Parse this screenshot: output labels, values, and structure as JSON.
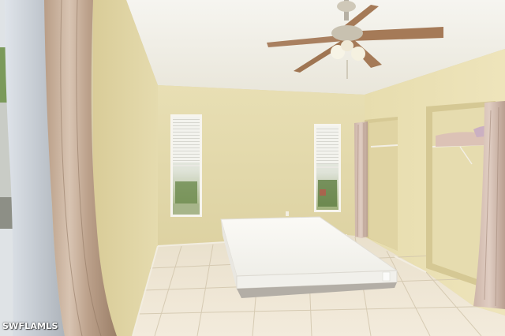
{
  "photo": {
    "watermark": "SWFLAMLS",
    "colors": {
      "ceiling": "#f3f1ea",
      "wall": "#e6dcae",
      "floor_tile": "#eee5d4",
      "grout": "#d3c8b3",
      "mattress": "#f4f3ef",
      "curtain": "#c9b3a0",
      "fan_blade": "#a57a57"
    }
  }
}
